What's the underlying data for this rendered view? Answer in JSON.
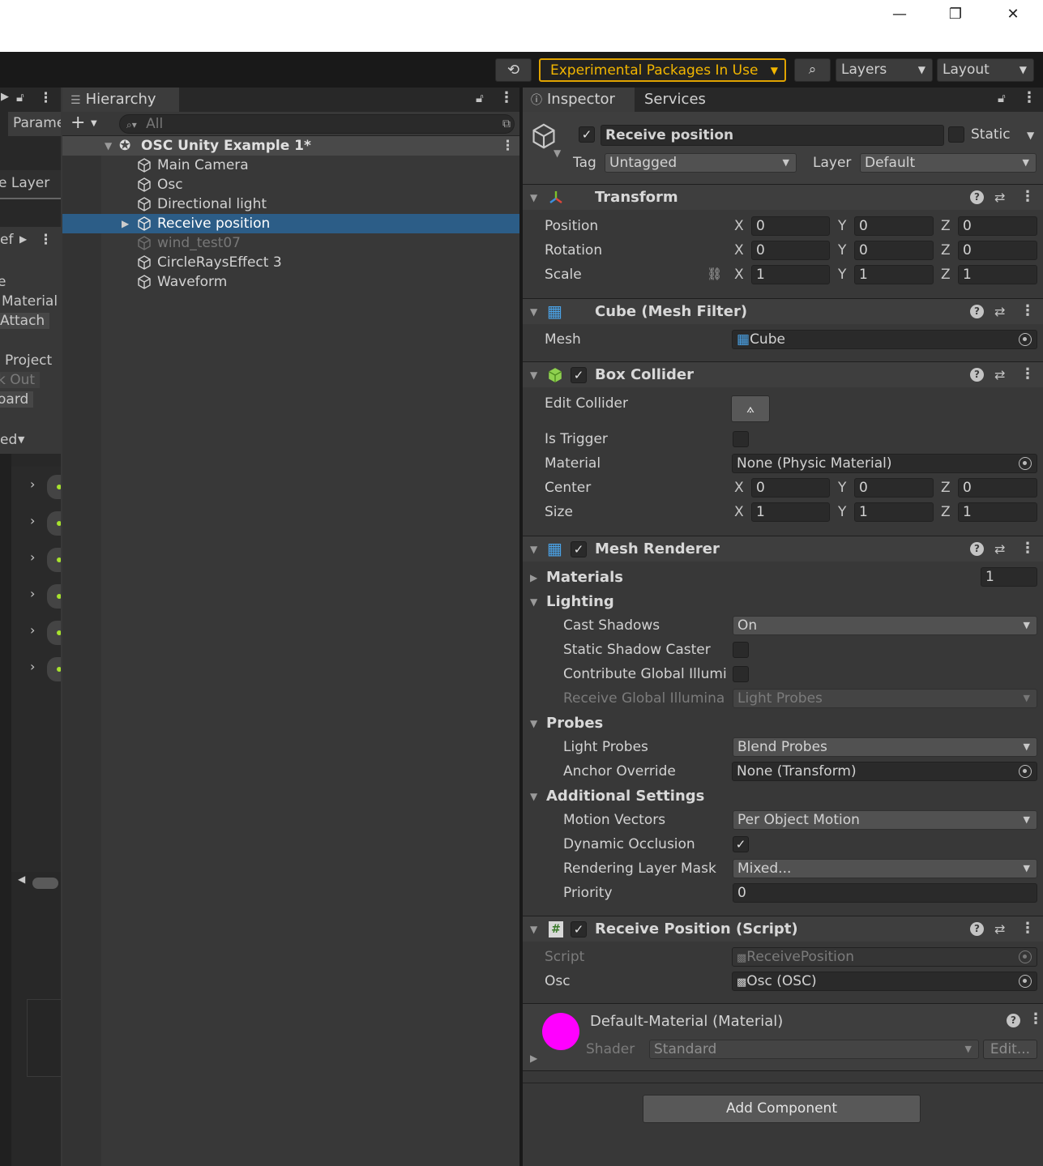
{
  "window": {
    "minimize": "—",
    "restore": "❐",
    "close": "✕"
  },
  "toolbar": {
    "experimental": "Experimental Packages In Use",
    "layers": "Layers",
    "layout": "Layout"
  },
  "left_panel": {
    "items": [
      "Parame",
      "e Layer",
      "ef",
      "e",
      "Material",
      "Attach",
      "Project",
      "k Out",
      "oard",
      "ed"
    ]
  },
  "hierarchy": {
    "tab": "Hierarchy",
    "search_placeholder": "All",
    "scene": "OSC Unity Example 1*",
    "items": [
      {
        "label": "Main Camera"
      },
      {
        "label": "Osc"
      },
      {
        "label": "Directional light"
      },
      {
        "label": "Receive position"
      },
      {
        "label": "wind_test07"
      },
      {
        "label": "CircleRaysEffect 3"
      },
      {
        "label": "Waveform"
      }
    ]
  },
  "inspector": {
    "tab": "Inspector",
    "tab2": "Services",
    "object_name": "Receive position",
    "static_label": "Static",
    "tag_label": "Tag",
    "tag_value": "Untagged",
    "layer_label": "Layer",
    "layer_value": "Default",
    "transform": {
      "title": "Transform",
      "position_label": "Position",
      "rotation_label": "Rotation",
      "scale_label": "Scale",
      "position": [
        "0",
        "0",
        "0"
      ],
      "rotation": [
        "0",
        "0",
        "0"
      ],
      "scale": [
        "1",
        "1",
        "1"
      ],
      "axes": [
        "X",
        "Y",
        "Z"
      ]
    },
    "mesh_filter": {
      "title": "Cube (Mesh Filter)",
      "mesh_label": "Mesh",
      "mesh_value": "Cube"
    },
    "box_collider": {
      "title": "Box Collider",
      "edit_label": "Edit Collider",
      "trigger_label": "Is Trigger",
      "material_label": "Material",
      "material_value": "None (Physic Material)",
      "center_label": "Center",
      "size_label": "Size",
      "center": [
        "0",
        "0",
        "0"
      ],
      "size": [
        "1",
        "1",
        "1"
      ]
    },
    "mesh_renderer": {
      "title": "Mesh Renderer",
      "materials_label": "Materials",
      "materials_count": "1",
      "lighting_label": "Lighting",
      "cast_shadows_label": "Cast Shadows",
      "cast_shadows_value": "On",
      "static_shadow_label": "Static Shadow Caster",
      "contribute_gi_label": "Contribute Global Illumi",
      "receive_gi_label": "Receive Global Illumina",
      "receive_gi_value": "Light Probes",
      "probes_label": "Probes",
      "light_probes_label": "Light Probes",
      "light_probes_value": "Blend Probes",
      "anchor_label": "Anchor Override",
      "anchor_value": "None (Transform)",
      "additional_label": "Additional Settings",
      "motion_label": "Motion Vectors",
      "motion_value": "Per Object Motion",
      "dynamic_label": "Dynamic Occlusion",
      "rendering_label": "Rendering Layer Mask",
      "rendering_value": "Mixed...",
      "priority_label": "Priority",
      "priority_value": "0"
    },
    "script": {
      "title": "Receive Position (Script)",
      "script_label": "Script",
      "script_value": "ReceivePosition",
      "osc_label": "Osc",
      "osc_value": "Osc (OSC)"
    },
    "material": {
      "title": "Default-Material (Material)",
      "shader_label": "Shader",
      "shader_value": "Standard",
      "edit_label": "Edit...",
      "swatch_color": "#ff00ff"
    },
    "add_component": "Add Component"
  },
  "colors": {
    "selection": "#2c5d87",
    "accent": "#f2b600"
  }
}
